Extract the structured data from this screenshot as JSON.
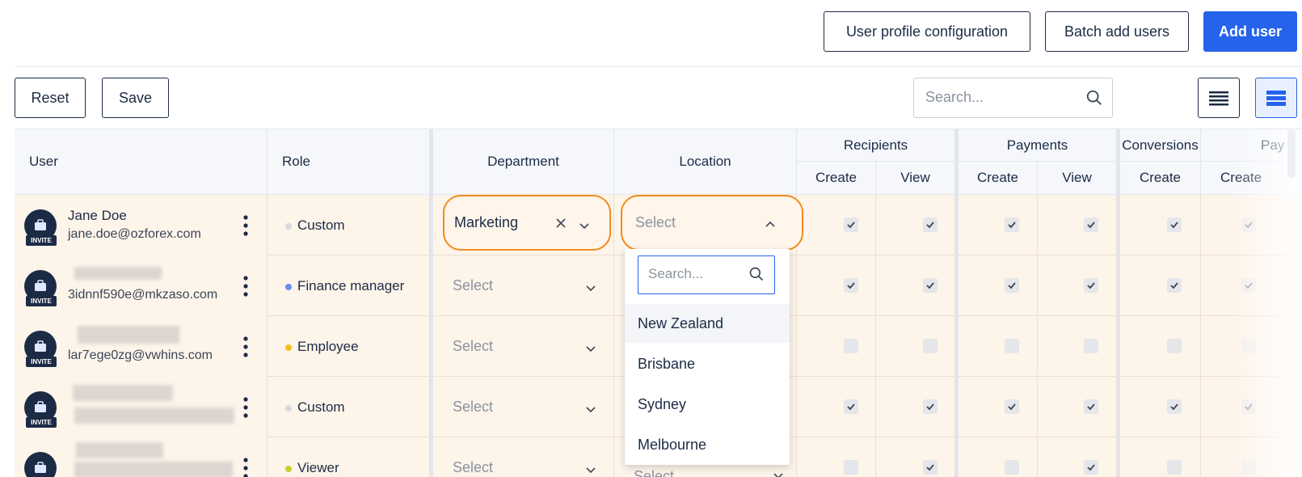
{
  "toolbar": {
    "user_profile_config_label": "User profile configuration",
    "batch_add_label": "Batch add users",
    "add_user_label": "Add user",
    "reset_label": "Reset",
    "save_label": "Save",
    "search_placeholder": "Search...",
    "primary_color": "#2563eb"
  },
  "columns": {
    "user": "User",
    "role": "Role",
    "department": "Department",
    "location": "Location",
    "groups": [
      {
        "label": "Recipients",
        "sub": [
          "Create",
          "View"
        ]
      },
      {
        "label": "Payments",
        "sub": [
          "Create",
          "View"
        ]
      },
      {
        "label": "Conversions",
        "sub": [
          "Create"
        ]
      },
      {
        "label": "Pay",
        "sub": [
          "Create"
        ]
      }
    ]
  },
  "badge_label": "INVITE",
  "select_placeholder": "Select",
  "rows": [
    {
      "name": "Jane Doe",
      "email": "jane.doe@ozforex.com",
      "role": "Custom",
      "role_color": "#d5d8de",
      "department": "Marketing",
      "location": "Select",
      "perms": [
        true,
        true,
        true,
        true,
        true,
        true
      ]
    },
    {
      "name": "",
      "email": "3idnnf590e@mkzaso.com",
      "role": "Finance manager",
      "role_color": "#6b8cf0",
      "department": "Select",
      "location": "",
      "perms": [
        true,
        true,
        true,
        true,
        true,
        true
      ]
    },
    {
      "name": "",
      "email": "lar7ege0zg@vwhins.com",
      "role": "Employee",
      "role_color": "#f2c21b",
      "department": "Select",
      "location": "",
      "perms": [
        false,
        false,
        false,
        false,
        false,
        false
      ]
    },
    {
      "name": "",
      "email": "",
      "role": "Custom",
      "role_color": "#d5d8de",
      "department": "Select",
      "location": "",
      "perms": [
        true,
        true,
        true,
        true,
        true,
        true
      ]
    },
    {
      "name": "",
      "email": "",
      "role": "Viewer",
      "role_color": "#c8cf2a",
      "department": "Select",
      "location": "Select",
      "perms": [
        false,
        true,
        false,
        true,
        false,
        false
      ]
    }
  ],
  "location_dropdown": {
    "search_placeholder": "Search...",
    "options": [
      "New Zealand",
      "Brisbane",
      "Sydney",
      "Melbourne"
    ]
  },
  "highlight_color": "#f28c1e"
}
